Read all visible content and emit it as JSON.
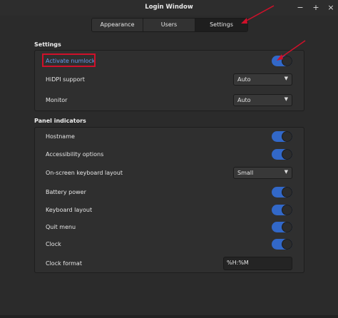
{
  "window": {
    "title": "Login Window"
  },
  "tabs": [
    {
      "label": "Appearance"
    },
    {
      "label": "Users"
    },
    {
      "label": "Settings"
    }
  ],
  "settings": {
    "title": "Settings",
    "numlock": {
      "label": "Activate numlock",
      "on": true
    },
    "hidpi": {
      "label": "HiDPI support",
      "value": "Auto"
    },
    "monitor": {
      "label": "Monitor",
      "value": "Auto"
    }
  },
  "panel": {
    "title": "Panel indicators",
    "hostname": {
      "label": "Hostname",
      "on": true
    },
    "accessibility": {
      "label": "Accessibility options",
      "on": true
    },
    "keyboard_layout_osk": {
      "label": "On-screen keyboard layout",
      "value": "Small"
    },
    "battery": {
      "label": "Battery power",
      "on": true
    },
    "keyboard_layout": {
      "label": "Keyboard layout",
      "on": true
    },
    "quit_menu": {
      "label": "Quit menu",
      "on": true
    },
    "clock": {
      "label": "Clock",
      "on": true
    },
    "clock_format": {
      "label": "Clock format",
      "value": "%H:%M"
    }
  },
  "colors": {
    "switch_on": "#3268c8",
    "highlight": "#d0102a",
    "arrow": "#d0102a"
  },
  "icons": {
    "minimize": "minimize-icon",
    "maximize": "maximize-icon",
    "close": "close-icon",
    "dropdown": "chevron-down-icon"
  }
}
